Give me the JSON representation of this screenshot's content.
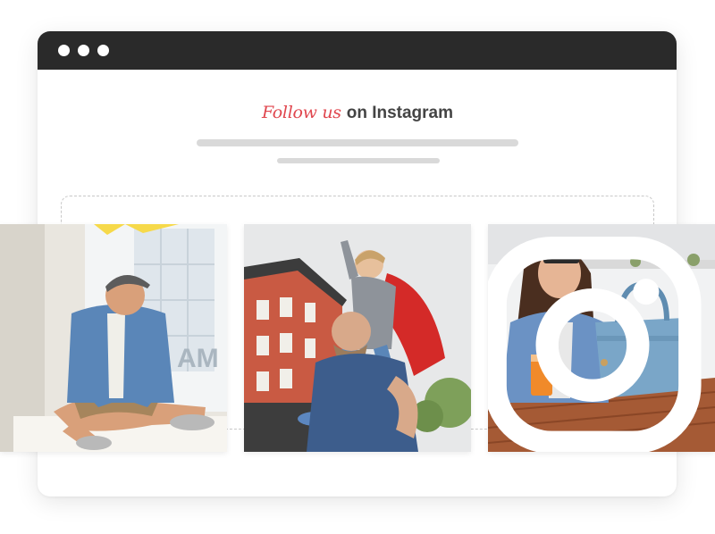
{
  "window": {
    "controls": [
      "dot-1",
      "dot-2",
      "dot-3"
    ]
  },
  "heading": {
    "script_text": "Follow us",
    "plain_text": "on Instagram"
  },
  "feed": {
    "posts": [
      {
        "icon": "none"
      },
      {
        "icon": "none"
      },
      {
        "icon": "instagram-icon"
      }
    ]
  }
}
